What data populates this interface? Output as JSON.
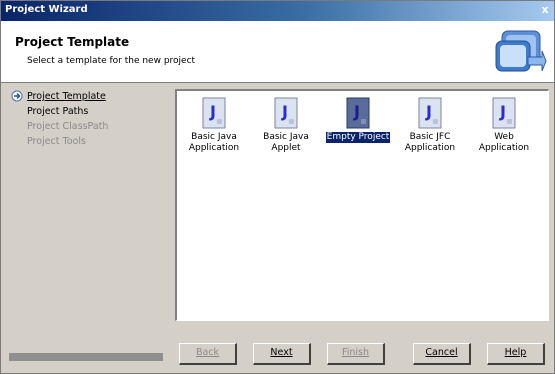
{
  "window": {
    "title": "Project Wizard",
    "close_label": "x"
  },
  "header": {
    "title": "Project Template",
    "subtitle": "Select a template for the new project"
  },
  "steps": [
    {
      "label": "Project Template",
      "state": "current"
    },
    {
      "label": "Project Paths",
      "state": "enabled"
    },
    {
      "label": "Project ClassPath",
      "state": "disabled"
    },
    {
      "label": "Project Tools",
      "state": "disabled"
    }
  ],
  "templates": [
    {
      "label_line1": "Basic Java",
      "label_line2": "Application",
      "selected": false
    },
    {
      "label_line1": "Basic Java",
      "label_line2": "Applet",
      "selected": false
    },
    {
      "label_line1": "Empty Project",
      "label_line2": "",
      "selected": true
    },
    {
      "label_line1": "Basic JFC",
      "label_line2": "Application",
      "selected": false
    },
    {
      "label_line1": "Web",
      "label_line2": "Application",
      "selected": false
    }
  ],
  "buttons": {
    "back": "Back",
    "next": "Next",
    "finish": "Finish",
    "cancel": "Cancel",
    "help": "Help"
  },
  "colors": {
    "title_bar": "#0a246a",
    "selection": "#0a246a",
    "java_icon_letter": "#2b2bd6"
  }
}
